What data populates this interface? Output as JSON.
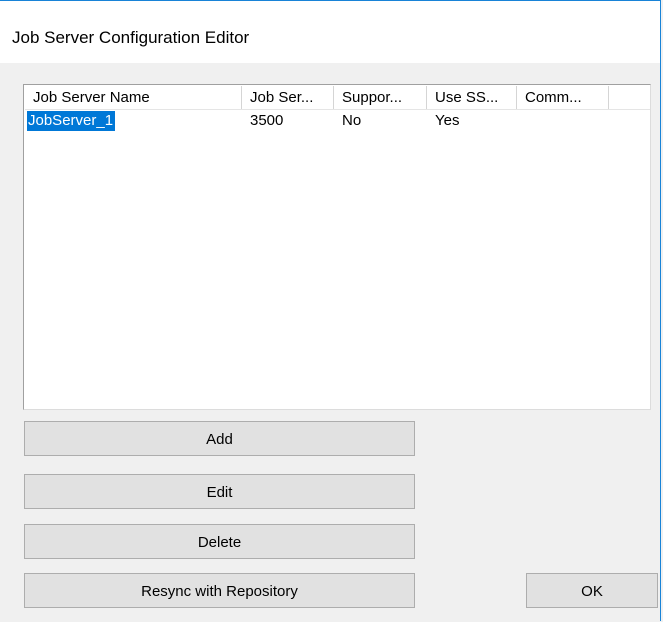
{
  "window": {
    "title": "Job Server Configuration Editor"
  },
  "list": {
    "columns": [
      {
        "label": "Job Server Name"
      },
      {
        "label": "Job Ser..."
      },
      {
        "label": "Suppor..."
      },
      {
        "label": "Use SS..."
      },
      {
        "label": "Comm..."
      },
      {
        "label": ""
      }
    ],
    "rows": [
      {
        "name": "JobServer_1",
        "port": "3500",
        "support": "No",
        "use_ssl": "Yes",
        "comment": "",
        "selected": true
      }
    ]
  },
  "buttons": {
    "add": "Add",
    "edit": "Edit",
    "delete": "Delete",
    "resync": "Resync with Repository",
    "ok": "OK"
  },
  "colors": {
    "selection": "#0078d7",
    "window_border": "#1883d7",
    "button_face": "#e1e1e1"
  }
}
